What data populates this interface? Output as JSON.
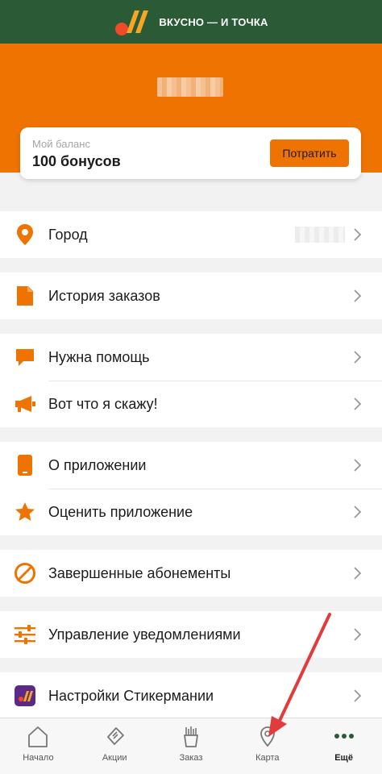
{
  "header": {
    "brand_text": "ВКУСНО — И ТОЧКА"
  },
  "balance": {
    "label": "Мой баланс",
    "value": "100 бонусов",
    "spend_label": "Потратить"
  },
  "menu": {
    "city": "Город",
    "order_history": "История заказов",
    "need_help": "Нужна помощь",
    "feedback": "Вот что я скажу!",
    "about_app": "О приложении",
    "rate_app": "Оценить приложение",
    "finished_subscriptions": "Завершенные абонементы",
    "notification_settings": "Управление уведомлениями",
    "stickermania_settings": "Настройки Стикермании"
  },
  "tabbar": {
    "home": "Начало",
    "promos": "Акции",
    "order": "Заказ",
    "map": "Карта",
    "more": "Ещё",
    "active": "more"
  },
  "colors": {
    "accent": "#ef7300",
    "header_green": "#2b5a37",
    "tab_active": "#2b5a37",
    "annotation_arrow": "#e23b3b"
  }
}
